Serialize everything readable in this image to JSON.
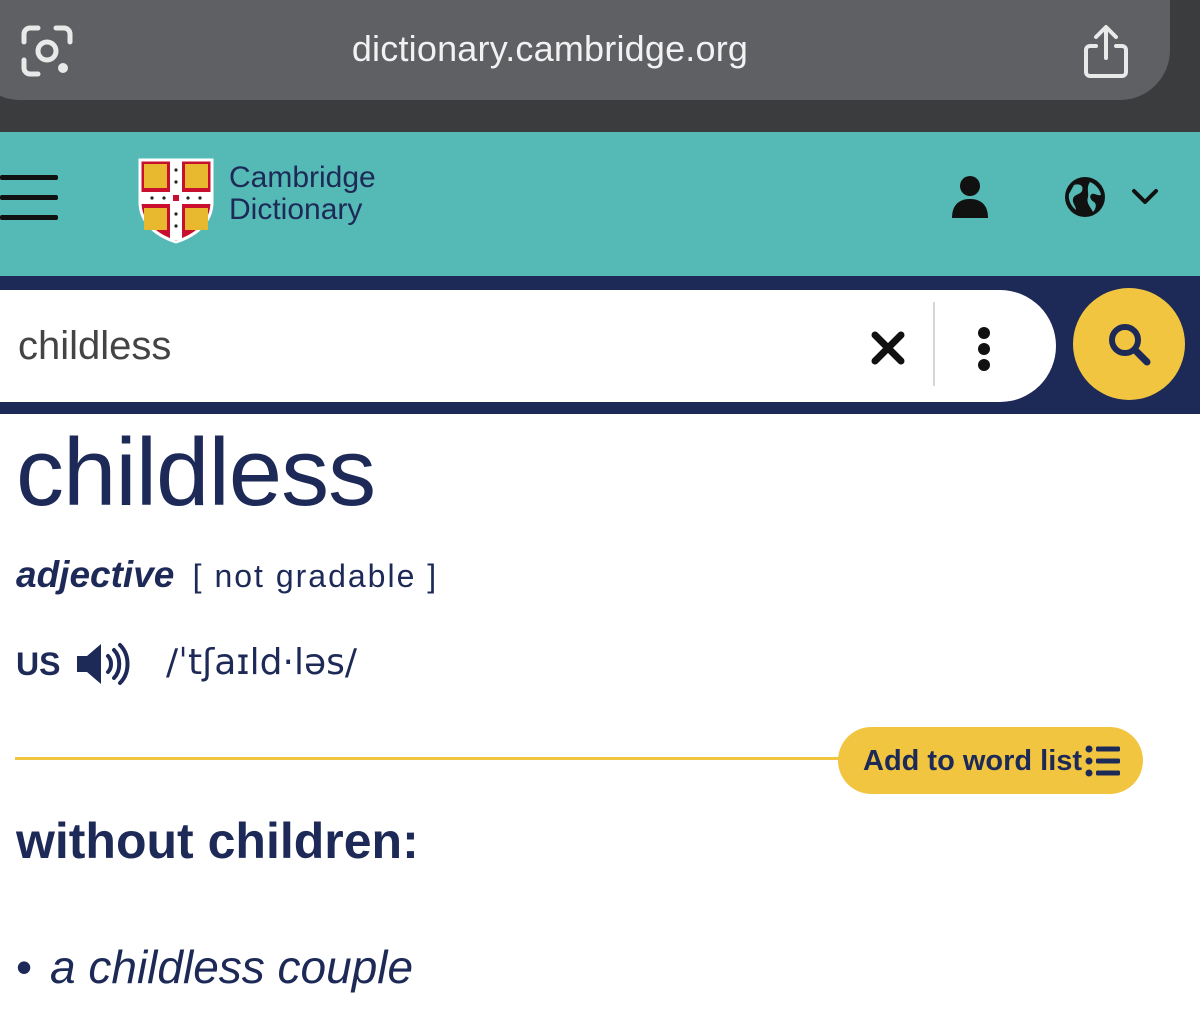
{
  "browser": {
    "url": "dictionary.cambridge.org",
    "lens_icon": "camera-search-icon",
    "share_icon": "share-icon"
  },
  "header": {
    "brand_line1": "Cambridge",
    "brand_line2": "Dictionary",
    "menu_icon": "hamburger-icon",
    "account_icon": "user-icon",
    "language_icon": "globe-icon",
    "colors": {
      "teal": "#55b9b5",
      "navy": "#1d2a57",
      "yellow": "#f2c541"
    }
  },
  "search": {
    "value": "childless",
    "clear_icon": "close-icon",
    "options_icon": "more-vertical-icon",
    "submit_icon": "search-icon"
  },
  "entry": {
    "headword": "childless",
    "part_of_speech": "adjective",
    "grammar": "[ not gradable ]",
    "region": "US",
    "ipa": "/ˈtʃaɪld·ləs/",
    "add_to_list": "Add to word list",
    "definition": "without children:",
    "bullet": "•",
    "example": "a childless couple"
  }
}
